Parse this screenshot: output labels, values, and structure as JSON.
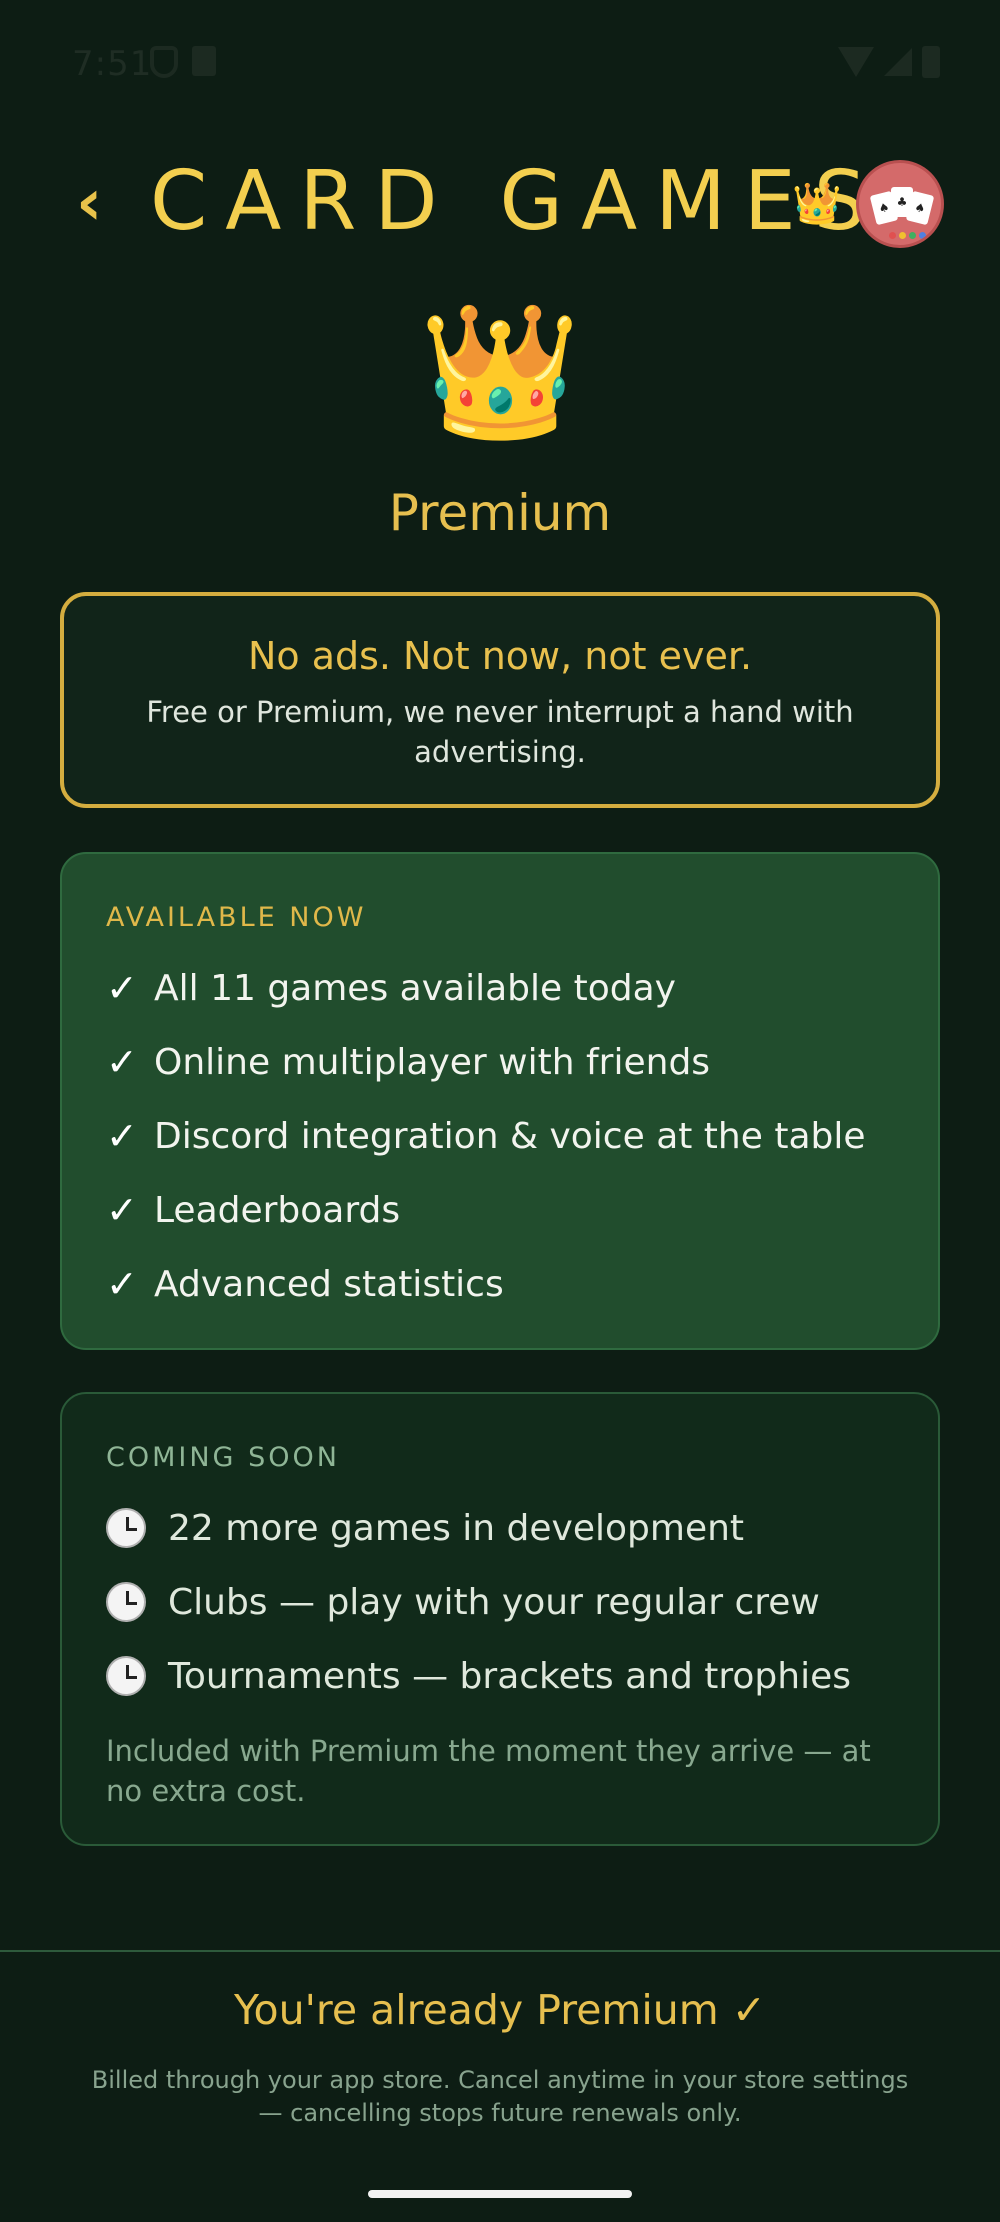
{
  "status_bar": {
    "time": "7:51"
  },
  "header": {
    "back_icon": "‹",
    "title": "CARD GAMES",
    "crown_icon": "👑"
  },
  "hero": {
    "crown_icon": "👑",
    "title": "Premium"
  },
  "ads_card": {
    "heading": "No ads. Not now, not ever.",
    "body": "Free or Premium, we never interrupt a hand with advertising."
  },
  "available_now": {
    "label": "AVAILABLE NOW",
    "check_icon": "✓",
    "items": [
      "All 11 games available today",
      "Online multiplayer with friends",
      "Discord integration & voice at the table",
      "Leaderboards",
      "Advanced statistics"
    ]
  },
  "coming_soon": {
    "label": "COMING SOON",
    "items": [
      "22 more games in development",
      "Clubs — play with your regular crew",
      "Tournaments — brackets and trophies"
    ],
    "note": "Included with Premium the moment they arrive — at no extra cost."
  },
  "footer": {
    "title": "You're already Premium ✓",
    "note": "Billed through your app store. Cancel anytime in your store settings — cancelling stops future renewals only."
  },
  "colors": {
    "background": "#0d1d14",
    "accent_gold": "#e6bf4f",
    "available_card": "#214d2d",
    "coming_card": "#112a1a"
  }
}
